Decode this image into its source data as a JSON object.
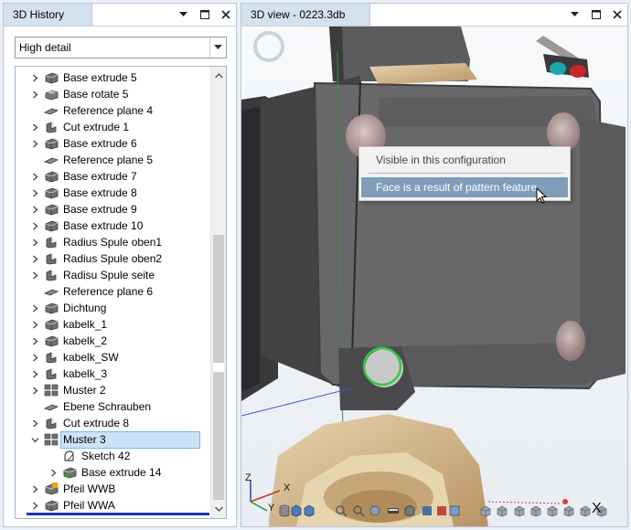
{
  "history_panel": {
    "title": "3D History",
    "detail_select": {
      "value": "High detail"
    },
    "tree": [
      {
        "label": "Base extrude 5",
        "icon": "extrude-icon",
        "indent": 0,
        "expand": "collapsed"
      },
      {
        "label": "Base rotate 5",
        "icon": "rotate-icon",
        "indent": 0,
        "expand": "collapsed"
      },
      {
        "label": "Reference plane 4",
        "icon": "plane-icon",
        "indent": 0,
        "expand": "none"
      },
      {
        "label": "Cut extrude 1",
        "icon": "cut-icon",
        "indent": 0,
        "expand": "collapsed"
      },
      {
        "label": "Base extrude 6",
        "icon": "extrude-icon",
        "indent": 0,
        "expand": "collapsed"
      },
      {
        "label": "Reference plane 5",
        "icon": "plane-icon",
        "indent": 0,
        "expand": "none"
      },
      {
        "label": "Base extrude 7",
        "icon": "extrude-icon",
        "indent": 0,
        "expand": "collapsed"
      },
      {
        "label": "Base extrude 8",
        "icon": "extrude-icon",
        "indent": 0,
        "expand": "collapsed"
      },
      {
        "label": "Base extrude 9",
        "icon": "extrude-icon",
        "indent": 0,
        "expand": "collapsed"
      },
      {
        "label": "Base extrude 10",
        "icon": "extrude-icon",
        "indent": 0,
        "expand": "collapsed"
      },
      {
        "label": "Radius Spule oben1",
        "icon": "cut-icon",
        "indent": 0,
        "expand": "collapsed"
      },
      {
        "label": "Radius Spule oben2",
        "icon": "cut-icon",
        "indent": 0,
        "expand": "collapsed"
      },
      {
        "label": "Radisu Spule seite",
        "icon": "cut-icon",
        "indent": 0,
        "expand": "collapsed"
      },
      {
        "label": "Reference plane 6",
        "icon": "plane-icon",
        "indent": 0,
        "expand": "none"
      },
      {
        "label": "Dichtung",
        "icon": "extrude-icon",
        "indent": 0,
        "expand": "collapsed"
      },
      {
        "label": "kabelk_1",
        "icon": "extrude-icon",
        "indent": 0,
        "expand": "collapsed"
      },
      {
        "label": "kabelk_2",
        "icon": "extrude-icon",
        "indent": 0,
        "expand": "collapsed"
      },
      {
        "label": "kabelk_SW",
        "icon": "cut-icon",
        "indent": 0,
        "expand": "collapsed"
      },
      {
        "label": "kabelk_3",
        "icon": "cut-icon",
        "indent": 0,
        "expand": "collapsed"
      },
      {
        "label": "Muster 2",
        "icon": "pattern-icon",
        "indent": 0,
        "expand": "collapsed"
      },
      {
        "label": "Ebene Schrauben",
        "icon": "plane-icon",
        "indent": 0,
        "expand": "none"
      },
      {
        "label": "Cut extrude 8",
        "icon": "cut-icon",
        "indent": 0,
        "expand": "collapsed"
      },
      {
        "label": "Muster 3",
        "icon": "pattern-icon",
        "indent": 0,
        "expand": "expanded",
        "selected": true
      },
      {
        "label": "Sketch 42",
        "icon": "sketch-icon",
        "indent": 1,
        "expand": "none"
      },
      {
        "label": "Base extrude 14",
        "icon": "extrude-green-icon",
        "indent": 1,
        "expand": "collapsed"
      },
      {
        "label": "Pfeil WWB",
        "icon": "extrude-warning-icon",
        "indent": 0,
        "expand": "collapsed"
      },
      {
        "label": "Pfeil WWA",
        "icon": "extrude-icon",
        "indent": 0,
        "expand": "collapsed"
      }
    ]
  },
  "view_panel": {
    "title": "3D view - 0223.3db",
    "context_menu": {
      "items": [
        {
          "label": "Visible in this configuration",
          "state": "normal"
        },
        {
          "label": "Face is a result of pattern feature",
          "state": "highlighted"
        }
      ]
    },
    "axis_labels": {
      "x": "X",
      "y": "Y",
      "z": "Z"
    },
    "toolbar_icons": [
      "cylinder-icon",
      "cube-icon",
      "cube-icon",
      "zoom-icon",
      "zoom-icon",
      "rotate-view-icon",
      "section-icon",
      "view-cube-icon",
      "shaded-icon",
      "render-icon",
      "wire-icon",
      "iso-view-icon",
      "front-view-icon",
      "top-view-icon",
      "side-view-icon",
      "back-view-icon",
      "bottom-view-icon",
      "left-view-icon",
      "right-view-icon"
    ]
  },
  "colors": {
    "panel_tab": "#d4e1ef",
    "selection": "#cde3f7",
    "menu_highlight": "#7f9db9",
    "model_dark": "#5a5a5c",
    "model_brass": "#cdb187"
  }
}
